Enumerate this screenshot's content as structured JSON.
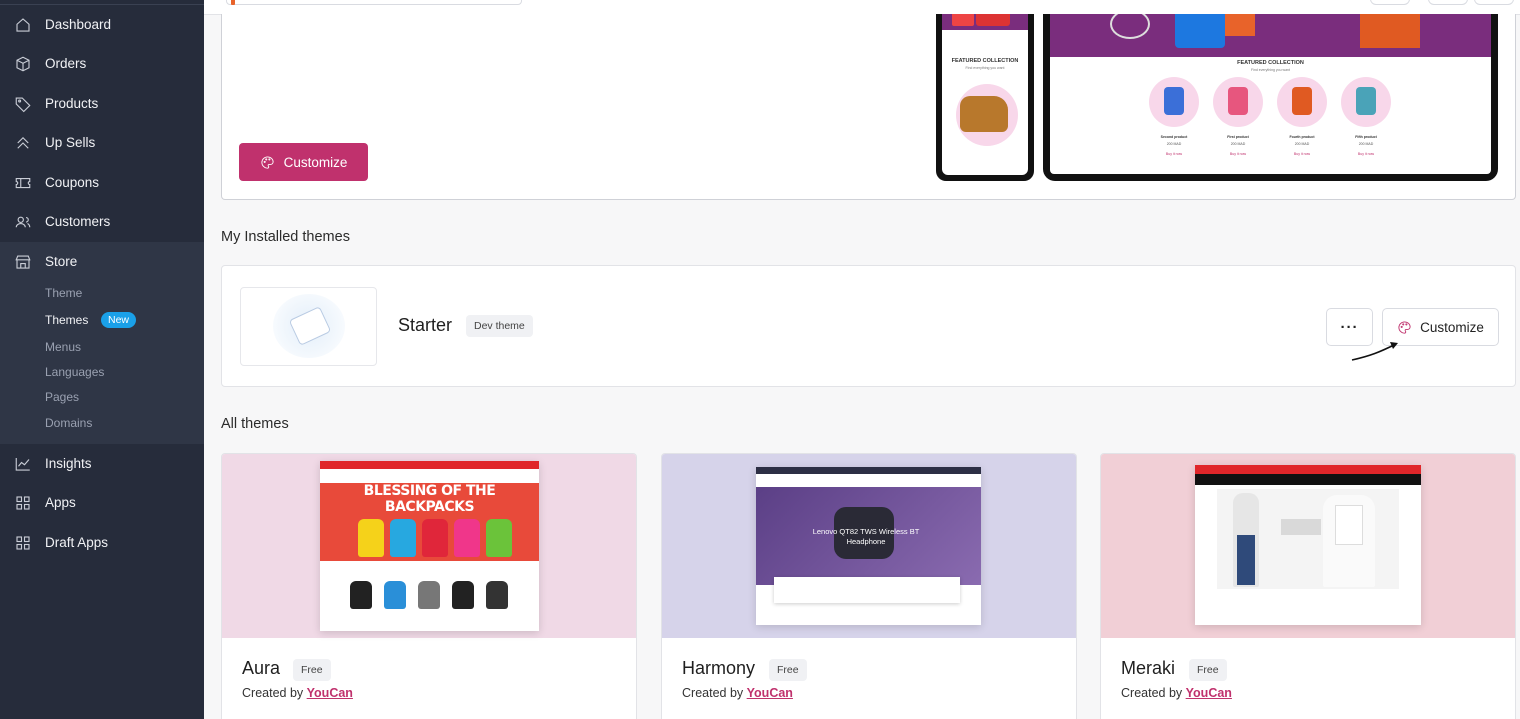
{
  "sidebar": {
    "items": [
      {
        "label": "Dashboard",
        "icon": "home-icon"
      },
      {
        "label": "Orders",
        "icon": "box-icon"
      },
      {
        "label": "Products",
        "icon": "tag-icon"
      },
      {
        "label": "Up Sells",
        "icon": "chevrons-up-icon"
      },
      {
        "label": "Coupons",
        "icon": "ticket-icon"
      },
      {
        "label": "Customers",
        "icon": "users-icon"
      },
      {
        "label": "Store",
        "icon": "store-icon"
      },
      {
        "label": "Insights",
        "icon": "chart-line-icon"
      },
      {
        "label": "Apps",
        "icon": "grid-icon"
      },
      {
        "label": "Draft Apps",
        "icon": "grid-icon"
      }
    ],
    "store_sub": [
      "Theme",
      "Themes",
      "Menus",
      "Languages",
      "Pages",
      "Domains"
    ],
    "new_badge": "New"
  },
  "current_theme": {
    "customize_label": "Customize",
    "preview": {
      "heading": "FEATURED COLLECTION",
      "subheading": "Find everything you want",
      "products": [
        {
          "name": "Second product",
          "price": "200 MAD",
          "buy": "Buy it now"
        },
        {
          "name": "First product",
          "price": "200 MAD",
          "buy": "Buy it now"
        },
        {
          "name": "Fourth product",
          "price": "200 MAD",
          "buy": "Buy it now"
        },
        {
          "name": "Fifth product",
          "price": "200 MAD",
          "buy": "Buy it now"
        }
      ]
    }
  },
  "installed": {
    "title": "My Installed themes",
    "theme_name": "Starter",
    "tag": "Dev theme",
    "more_label": "···",
    "customize_label": "Customize"
  },
  "all_themes": {
    "title": "All themes",
    "created_by": "Created by",
    "themes": [
      {
        "name": "Aura",
        "price": "Free",
        "author": "YouCan",
        "preview_heading": "BLESSING OF THE BACKPACKS",
        "bg": "#f0d9e6"
      },
      {
        "name": "Harmony",
        "price": "Free",
        "author": "YouCan",
        "preview_heading": "Lenovo QT82 TWS Wireless BT Headphone",
        "bg": "#d6d3ea"
      },
      {
        "name": "Meraki",
        "price": "Free",
        "author": "YouCan",
        "preview_heading": "",
        "bg": "#f1cfd6"
      }
    ]
  },
  "colors": {
    "accent": "#c0316d",
    "sidebar_bg": "#262c3b",
    "badge_blue": "#1aa0e8"
  }
}
